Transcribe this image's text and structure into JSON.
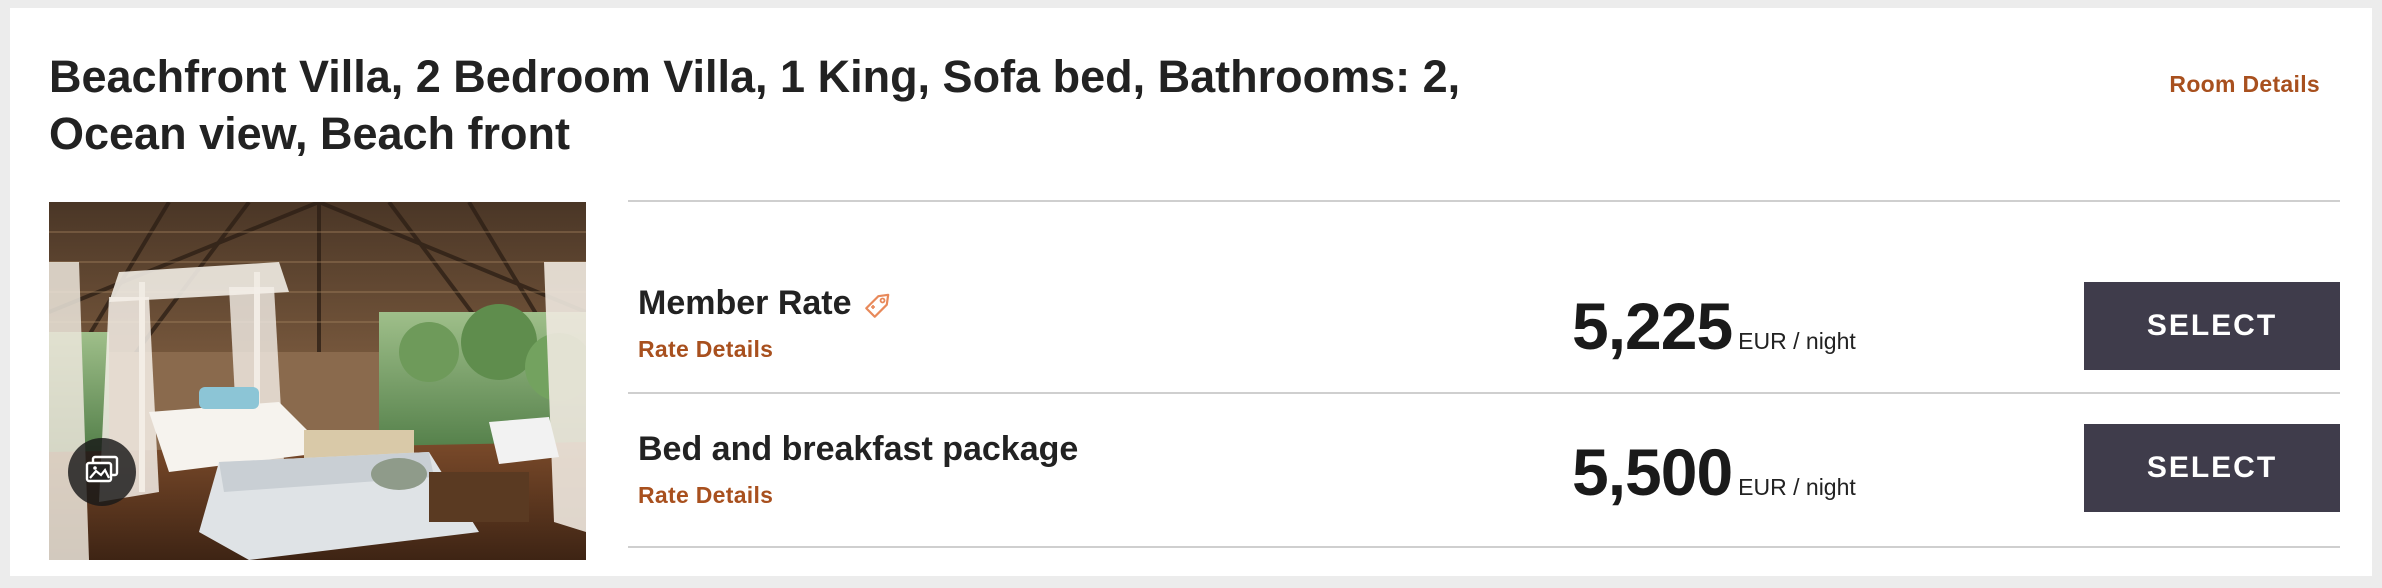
{
  "room": {
    "title": "Beachfront Villa, 2 Bedroom Villa, 1 King, Sofa bed, Bathrooms: 2, Ocean view, Beach front",
    "details_link": "Room Details",
    "photo_alt": "Beachfront villa bedroom with canopy bed",
    "gallery_icon": "gallery-icon"
  },
  "rates": [
    {
      "name": "Member Rate",
      "has_member_tag": true,
      "tag_icon": "tag-icon",
      "details_link": "Rate Details",
      "price": "5,225",
      "unit": "EUR / night",
      "select_label": "SELECT"
    },
    {
      "name": "Bed and breakfast package",
      "has_member_tag": false,
      "details_link": "Rate Details",
      "price": "5,500",
      "unit": "EUR / night",
      "select_label": "SELECT"
    }
  ],
  "colors": {
    "accent": "#a8501e",
    "button": "#3f3c4b",
    "divider": "#cfcfcf",
    "tag_icon": "#e8895a"
  }
}
